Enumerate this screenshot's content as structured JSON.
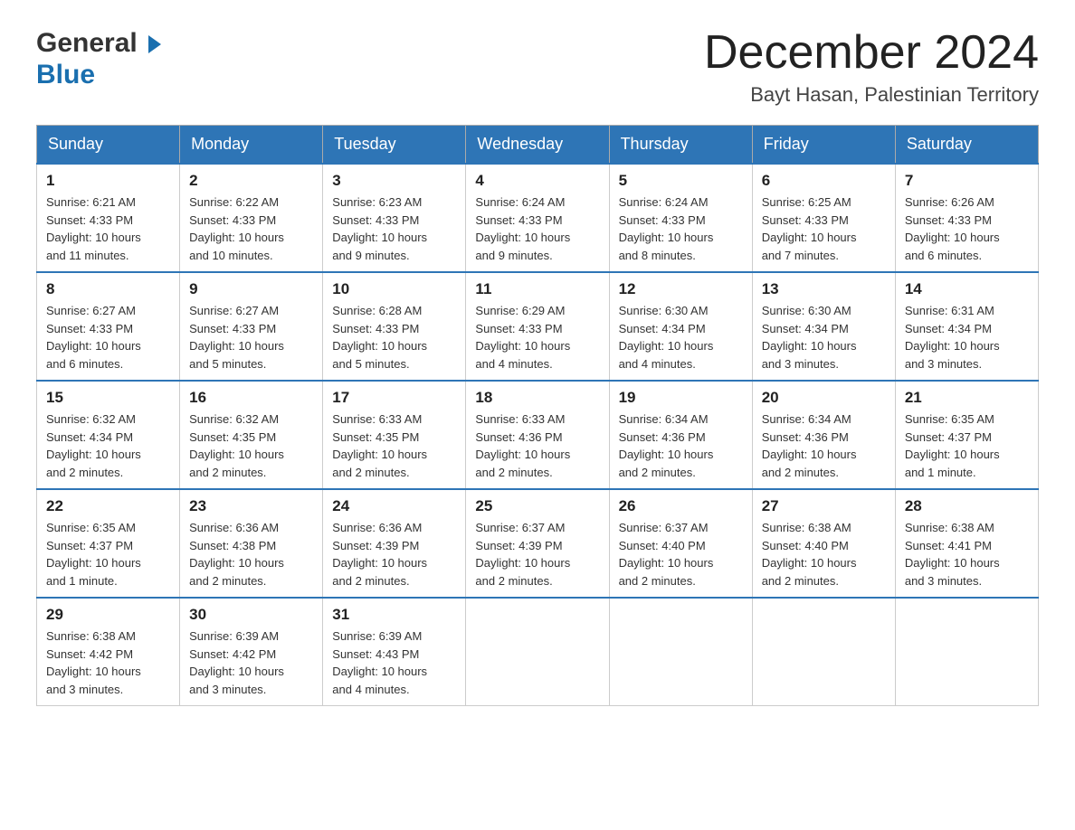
{
  "header": {
    "logo_line1": "General",
    "logo_line2": "Blue",
    "month_title": "December 2024",
    "location": "Bayt Hasan, Palestinian Territory"
  },
  "days_of_week": [
    "Sunday",
    "Monday",
    "Tuesday",
    "Wednesday",
    "Thursday",
    "Friday",
    "Saturday"
  ],
  "weeks": [
    [
      {
        "day": "1",
        "sunrise": "6:21 AM",
        "sunset": "4:33 PM",
        "daylight": "10 hours and 11 minutes."
      },
      {
        "day": "2",
        "sunrise": "6:22 AM",
        "sunset": "4:33 PM",
        "daylight": "10 hours and 10 minutes."
      },
      {
        "day": "3",
        "sunrise": "6:23 AM",
        "sunset": "4:33 PM",
        "daylight": "10 hours and 9 minutes."
      },
      {
        "day": "4",
        "sunrise": "6:24 AM",
        "sunset": "4:33 PM",
        "daylight": "10 hours and 9 minutes."
      },
      {
        "day": "5",
        "sunrise": "6:24 AM",
        "sunset": "4:33 PM",
        "daylight": "10 hours and 8 minutes."
      },
      {
        "day": "6",
        "sunrise": "6:25 AM",
        "sunset": "4:33 PM",
        "daylight": "10 hours and 7 minutes."
      },
      {
        "day": "7",
        "sunrise": "6:26 AM",
        "sunset": "4:33 PM",
        "daylight": "10 hours and 6 minutes."
      }
    ],
    [
      {
        "day": "8",
        "sunrise": "6:27 AM",
        "sunset": "4:33 PM",
        "daylight": "10 hours and 6 minutes."
      },
      {
        "day": "9",
        "sunrise": "6:27 AM",
        "sunset": "4:33 PM",
        "daylight": "10 hours and 5 minutes."
      },
      {
        "day": "10",
        "sunrise": "6:28 AM",
        "sunset": "4:33 PM",
        "daylight": "10 hours and 5 minutes."
      },
      {
        "day": "11",
        "sunrise": "6:29 AM",
        "sunset": "4:33 PM",
        "daylight": "10 hours and 4 minutes."
      },
      {
        "day": "12",
        "sunrise": "6:30 AM",
        "sunset": "4:34 PM",
        "daylight": "10 hours and 4 minutes."
      },
      {
        "day": "13",
        "sunrise": "6:30 AM",
        "sunset": "4:34 PM",
        "daylight": "10 hours and 3 minutes."
      },
      {
        "day": "14",
        "sunrise": "6:31 AM",
        "sunset": "4:34 PM",
        "daylight": "10 hours and 3 minutes."
      }
    ],
    [
      {
        "day": "15",
        "sunrise": "6:32 AM",
        "sunset": "4:34 PM",
        "daylight": "10 hours and 2 minutes."
      },
      {
        "day": "16",
        "sunrise": "6:32 AM",
        "sunset": "4:35 PM",
        "daylight": "10 hours and 2 minutes."
      },
      {
        "day": "17",
        "sunrise": "6:33 AM",
        "sunset": "4:35 PM",
        "daylight": "10 hours and 2 minutes."
      },
      {
        "day": "18",
        "sunrise": "6:33 AM",
        "sunset": "4:36 PM",
        "daylight": "10 hours and 2 minutes."
      },
      {
        "day": "19",
        "sunrise": "6:34 AM",
        "sunset": "4:36 PM",
        "daylight": "10 hours and 2 minutes."
      },
      {
        "day": "20",
        "sunrise": "6:34 AM",
        "sunset": "4:36 PM",
        "daylight": "10 hours and 2 minutes."
      },
      {
        "day": "21",
        "sunrise": "6:35 AM",
        "sunset": "4:37 PM",
        "daylight": "10 hours and 1 minute."
      }
    ],
    [
      {
        "day": "22",
        "sunrise": "6:35 AM",
        "sunset": "4:37 PM",
        "daylight": "10 hours and 1 minute."
      },
      {
        "day": "23",
        "sunrise": "6:36 AM",
        "sunset": "4:38 PM",
        "daylight": "10 hours and 2 minutes."
      },
      {
        "day": "24",
        "sunrise": "6:36 AM",
        "sunset": "4:39 PM",
        "daylight": "10 hours and 2 minutes."
      },
      {
        "day": "25",
        "sunrise": "6:37 AM",
        "sunset": "4:39 PM",
        "daylight": "10 hours and 2 minutes."
      },
      {
        "day": "26",
        "sunrise": "6:37 AM",
        "sunset": "4:40 PM",
        "daylight": "10 hours and 2 minutes."
      },
      {
        "day": "27",
        "sunrise": "6:38 AM",
        "sunset": "4:40 PM",
        "daylight": "10 hours and 2 minutes."
      },
      {
        "day": "28",
        "sunrise": "6:38 AM",
        "sunset": "4:41 PM",
        "daylight": "10 hours and 3 minutes."
      }
    ],
    [
      {
        "day": "29",
        "sunrise": "6:38 AM",
        "sunset": "4:42 PM",
        "daylight": "10 hours and 3 minutes."
      },
      {
        "day": "30",
        "sunrise": "6:39 AM",
        "sunset": "4:42 PM",
        "daylight": "10 hours and 3 minutes."
      },
      {
        "day": "31",
        "sunrise": "6:39 AM",
        "sunset": "4:43 PM",
        "daylight": "10 hours and 4 minutes."
      },
      null,
      null,
      null,
      null
    ]
  ],
  "labels": {
    "sunrise": "Sunrise:",
    "sunset": "Sunset:",
    "daylight": "Daylight:"
  }
}
